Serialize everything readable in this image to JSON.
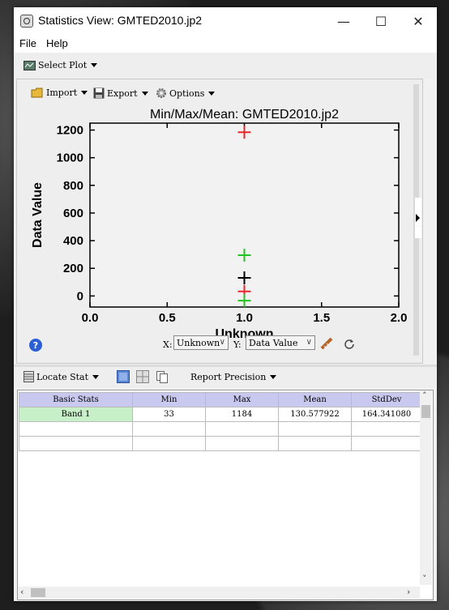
{
  "window": {
    "title": "Statistics View: GMTED2010.jp2",
    "minimize": "—",
    "maximize": "☐",
    "close": "✕"
  },
  "menu": [
    "File",
    "Help"
  ],
  "toolbar": {
    "select_plot": "Select Plot"
  },
  "plot_toolbar": {
    "import": "Import",
    "export": "Export",
    "options": "Options"
  },
  "chart_data": {
    "type": "scatter",
    "title": "Min/Max/Mean: GMTED2010.jp2",
    "xlabel": "Unknown",
    "ylabel": "Data Value",
    "xlim": [
      0.0,
      2.0
    ],
    "ylim": [
      -80,
      1250
    ],
    "x_ticks": [
      "0.0",
      "0.5",
      "1.0",
      "1.5",
      "2.0"
    ],
    "y_ticks": [
      "0",
      "200",
      "400",
      "600",
      "800",
      "1000",
      "1200"
    ],
    "series": [
      {
        "marker": "+",
        "color": "#e8262a",
        "points": [
          [
            1.0,
            1184
          ],
          [
            1.0,
            33
          ]
        ]
      },
      {
        "marker": "+",
        "color": "#21c321",
        "points": [
          [
            1.0,
            295
          ],
          [
            1.0,
            -34
          ]
        ]
      },
      {
        "marker": "+",
        "color": "#000000",
        "points": [
          [
            1.0,
            131
          ]
        ]
      }
    ]
  },
  "axis_controls": {
    "x_label": "X:",
    "x_value": "Unknown",
    "y_label": "Y:",
    "y_value": "Data Value"
  },
  "stats_toolbar": {
    "locate_stat": "Locate Stat",
    "report_precision": "Report Precision"
  },
  "table": {
    "columns": [
      "Basic Stats",
      "Min",
      "Max",
      "Mean",
      "StdDev"
    ],
    "rows": [
      [
        "Band 1",
        "33",
        "1184",
        "130.577922",
        "164.341080"
      ]
    ]
  },
  "colors": {
    "header": "#c9c9f0",
    "band_cell": "#c8f0c8",
    "accent": "#2c5fd6"
  }
}
